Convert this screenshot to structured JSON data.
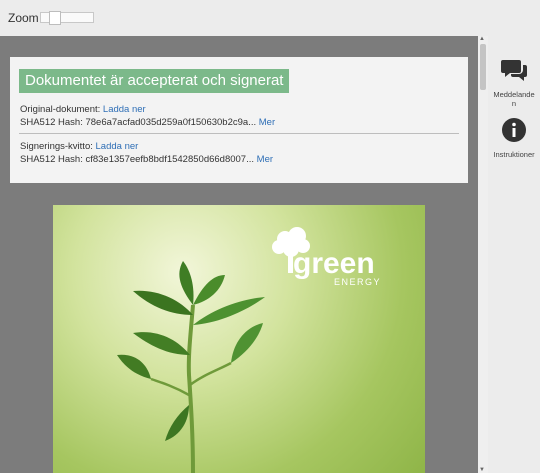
{
  "toolbar": {
    "zoom_label": "Zoom",
    "zoom_value": 0.2
  },
  "status": {
    "banner": "Dokumentet är accepterat och signerat",
    "original_label": "Original-dokument:",
    "original_link": "Ladda ner",
    "original_hash": "SHA512 Hash: 78e6a7acfad035d259a0f150630b2c9a...",
    "original_more": "Mer",
    "receipt_label": "Signerings-kvitto:",
    "receipt_link": "Ladda ner",
    "receipt_hash": "SHA512 Hash: cf83e1357eefb8bdf1542850d66d8007...",
    "receipt_more": "Mer"
  },
  "document": {
    "brand": "green",
    "brand_sub": "ENERGY"
  },
  "sidebar": {
    "messages_label": "Meddelanden",
    "instructions_label": "Instruktioner"
  },
  "colors": {
    "accepted": "#7cb98a",
    "link": "#2f6fb6",
    "viewer_bg": "#7c7c7c"
  }
}
